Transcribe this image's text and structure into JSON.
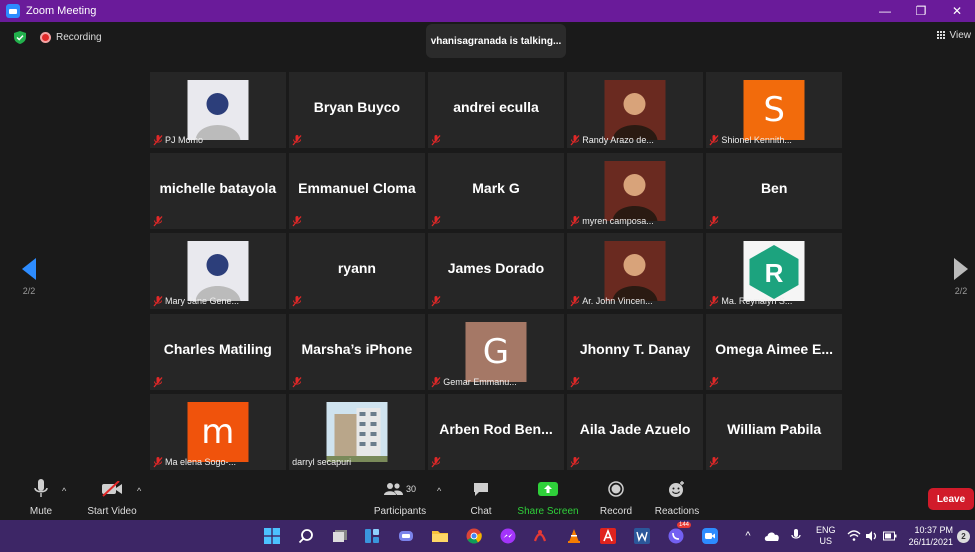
{
  "window": {
    "title": "Zoom Meeting"
  },
  "status": {
    "recording_label": "Recording",
    "talking": "vhanisagranada is talking...",
    "view_label": "View"
  },
  "pagination": {
    "left": "2/2",
    "right": "2/2"
  },
  "participants": [
    {
      "name": "PJ Momo",
      "big": "",
      "type": "photo",
      "muted": true
    },
    {
      "name": "",
      "big": "Bryan Buyco",
      "type": "name",
      "muted": true
    },
    {
      "name": "",
      "big": "andrei eculla",
      "type": "name",
      "muted": true
    },
    {
      "name": "Randy Arazo de...",
      "big": "",
      "type": "photo",
      "muted": true
    },
    {
      "name": "Shionel Kennith...",
      "big": "",
      "type": "letter",
      "letter": "S",
      "color": "#f26b0c",
      "muted": true
    },
    {
      "name": "",
      "big": "michelle batayola",
      "type": "name",
      "muted": true
    },
    {
      "name": "",
      "big": "Emmanuel Cloma",
      "type": "name",
      "muted": true
    },
    {
      "name": "",
      "big": "Mark G",
      "type": "name",
      "muted": true
    },
    {
      "name": "myren camposa...",
      "big": "",
      "type": "photo",
      "muted": true
    },
    {
      "name": "",
      "big": "Ben",
      "type": "name",
      "muted": true
    },
    {
      "name": "Mary Jane Gene...",
      "big": "",
      "type": "photo",
      "muted": true
    },
    {
      "name": "",
      "big": "ryann",
      "type": "name",
      "muted": true
    },
    {
      "name": "",
      "big": "James Dorado",
      "type": "name",
      "muted": true
    },
    {
      "name": "Ar. John Vincen...",
      "big": "",
      "type": "photo",
      "muted": true
    },
    {
      "name": "Ma. Reynalyn S...",
      "big": "",
      "type": "logo",
      "letter": "R",
      "muted": true
    },
    {
      "name": "",
      "big": "Charles Matiling",
      "type": "name",
      "muted": true
    },
    {
      "name": "",
      "big": "Marsha’s iPhone",
      "type": "name",
      "muted": true
    },
    {
      "name": "Gemar Emmanu...",
      "big": "",
      "type": "letter",
      "letter": "G",
      "color": "#a57866",
      "muted": true
    },
    {
      "name": "",
      "big": "Jhonny T. Danay",
      "type": "name",
      "muted": true
    },
    {
      "name": "",
      "big": "Omega Aimee E...",
      "type": "name",
      "muted": true
    },
    {
      "name": "Ma elena Sogo-...",
      "big": "",
      "type": "letter",
      "letter": "m",
      "color": "#f0530c",
      "muted": true
    },
    {
      "name": "darryl secapuri",
      "big": "",
      "type": "building",
      "muted": false
    },
    {
      "name": "",
      "big": "Arben Rod Ben...",
      "type": "name",
      "muted": true
    },
    {
      "name": "",
      "big": "Aila Jade Azuelo",
      "type": "name",
      "muted": true
    },
    {
      "name": "",
      "big": "William Pabila",
      "type": "name",
      "muted": true
    }
  ],
  "toolbar": {
    "mute": "Mute",
    "start_video": "Start Video",
    "participants": "Participants",
    "participant_count": "30",
    "chat": "Chat",
    "share_screen": "Share Screen",
    "record": "Record",
    "reactions": "Reactions",
    "leave": "Leave"
  },
  "taskbar": {
    "lang": "ENG",
    "region": "US",
    "time": "10:37 PM",
    "date": "26/11/2021",
    "messenger_badge": "144",
    "notifications": "2"
  },
  "colors": {
    "accent": "#2d8cff",
    "titlebar": "#6a1b9a",
    "leave": "#d11b2a",
    "share": "#2fd03a",
    "taskbar": "#3d2666"
  }
}
